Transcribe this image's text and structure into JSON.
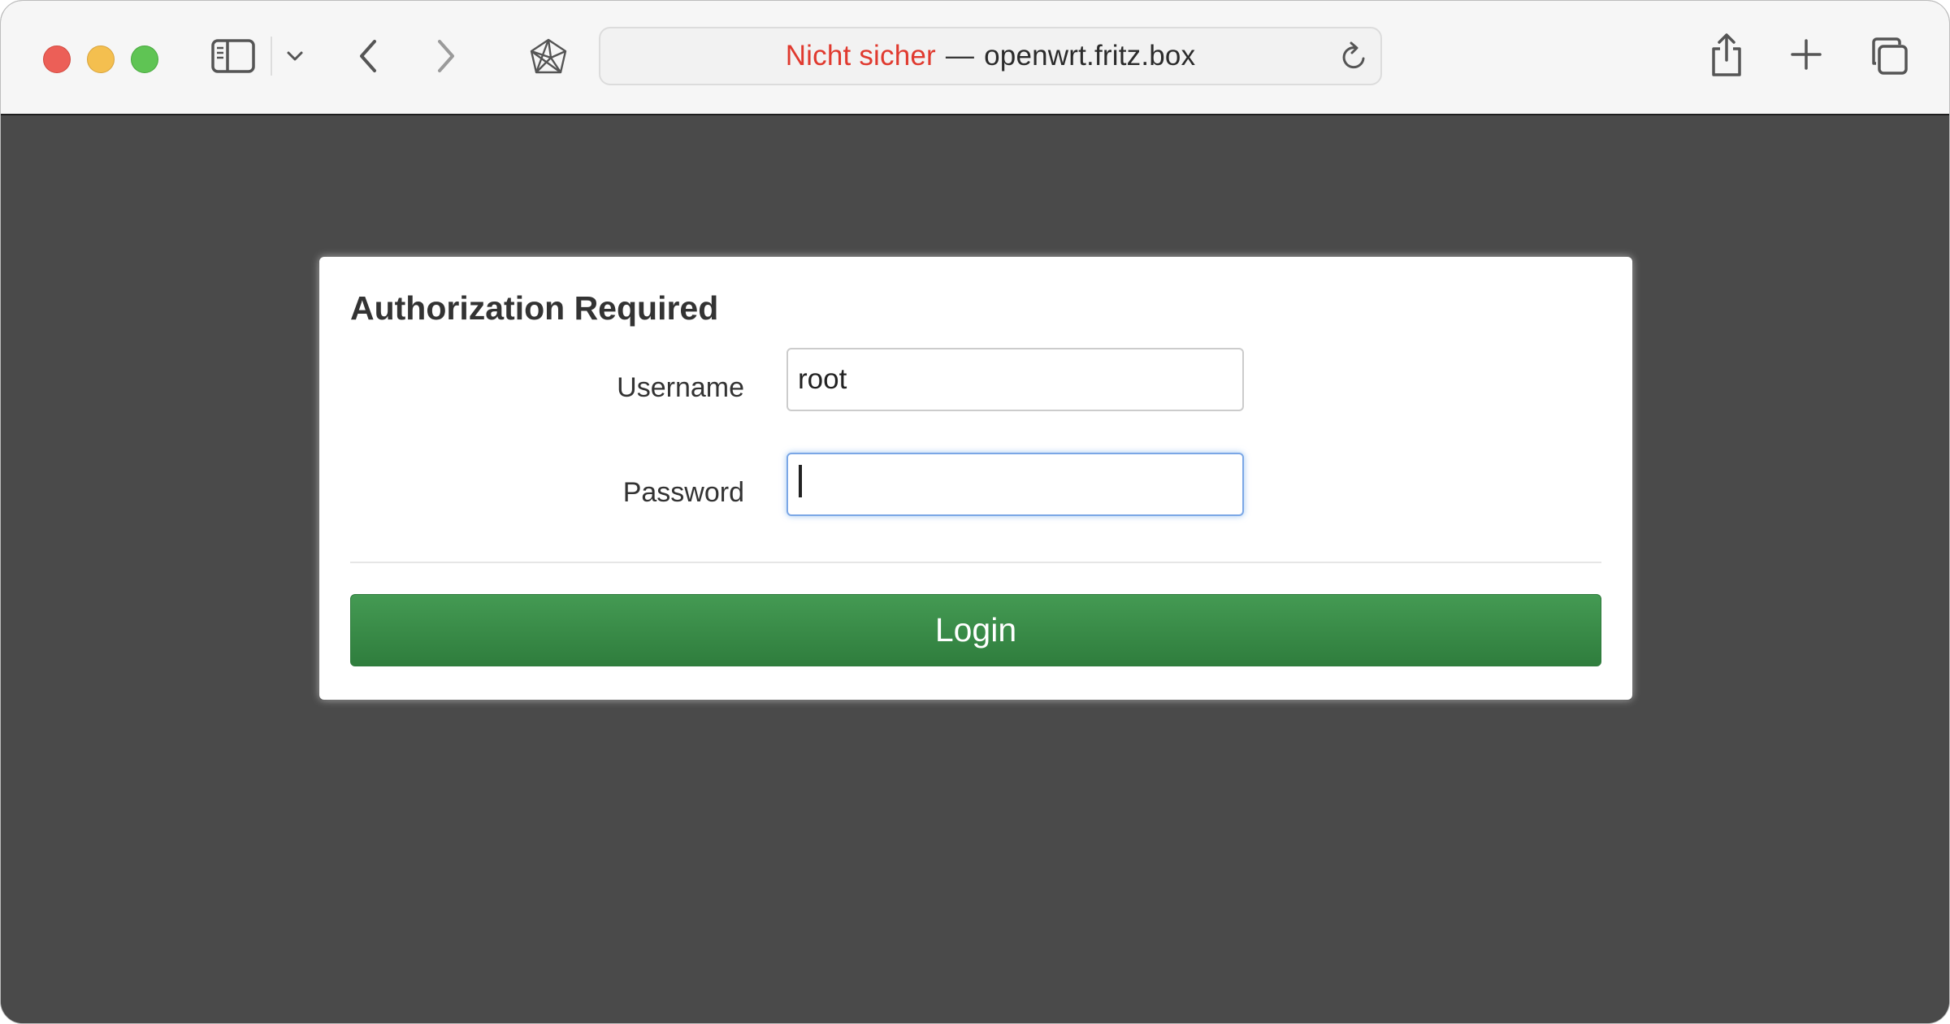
{
  "browser": {
    "address": {
      "security_status": "Nicht sicher",
      "separator": "—",
      "host": "openwrt.fritz.box"
    }
  },
  "page": {
    "title": "Authorization Required",
    "username_label": "Username",
    "username_value": "root",
    "password_label": "Password",
    "password_value": "",
    "login_label": "Login"
  },
  "icons": {
    "sidebar": "sidebar-icon",
    "tab_group_menu": "chevron-down-icon",
    "back": "chevron-left-icon",
    "forward": "chevron-right-icon",
    "site": "network-icon",
    "reload": "reload-icon",
    "share": "share-icon",
    "new_tab": "plus-icon",
    "tabs_overview": "tabs-overview-icon"
  },
  "colors": {
    "insecure": "#e03a2f",
    "login_button": "#3a8a48",
    "background": "#4a4a4a"
  }
}
